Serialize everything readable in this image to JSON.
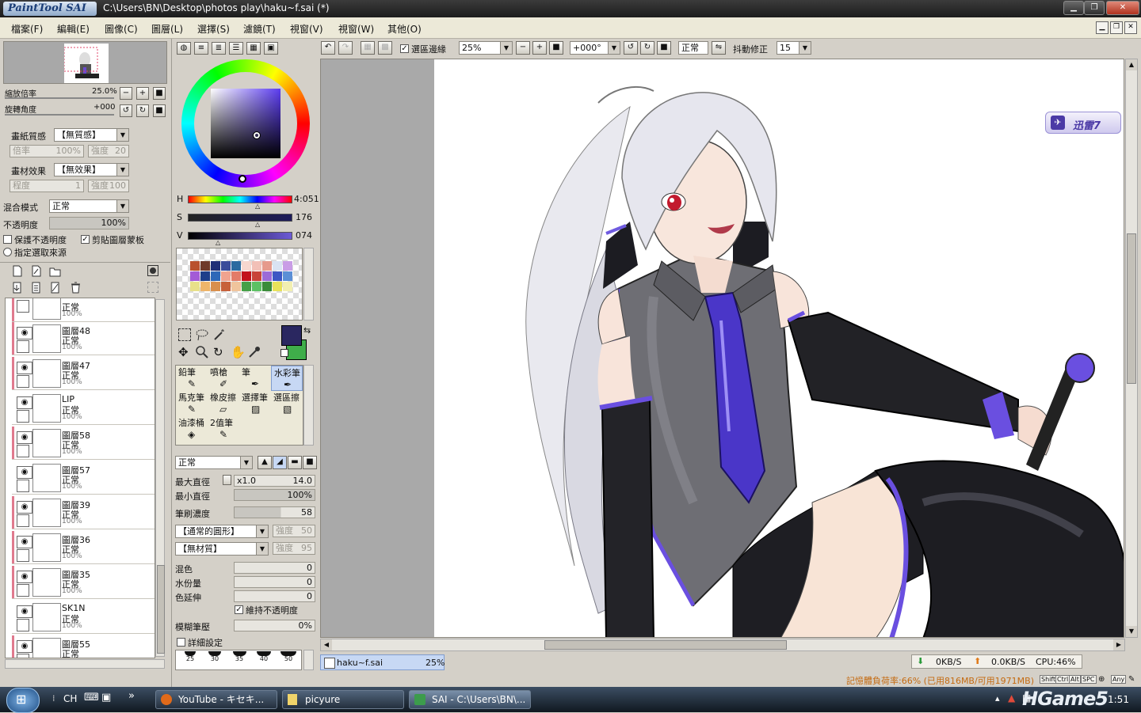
{
  "window": {
    "logo": "PaintTool SAI",
    "title": "C:\\Users\\BN\\Desktop\\photos play\\haku~f.sai (*)"
  },
  "menu": [
    "檔案(F)",
    "編輯(E)",
    "圖像(C)",
    "圖層(L)",
    "選擇(S)",
    "濾鏡(T)",
    "視窗(V)",
    "視窗(W)",
    "其他(O)"
  ],
  "navigator": {
    "zoom_label": "縮放倍率",
    "zoom_value": "25.0%",
    "rotate_label": "旋轉角度",
    "rotate_value": "+000"
  },
  "layer_props": {
    "paper_label": "畫紙質感",
    "paper_value": "【無質感】",
    "paper_scale_label": "倍率",
    "paper_scale_value": "100%",
    "paper_strength_label": "強度",
    "paper_strength_value": "20",
    "effect_label": "畫材效果",
    "effect_value": "【無效果】",
    "effect_degree_label": "程度",
    "effect_degree_value": "1",
    "effect_strength_label": "強度",
    "effect_strength_value": "100",
    "blend_label": "混合模式",
    "blend_value": "正常",
    "opacity_label": "不透明度",
    "opacity_value": "100%",
    "protect_label": "保護不透明度",
    "clip_label": "剪貼圖層蒙板",
    "source_label": "指定選取來源"
  },
  "layers": [
    {
      "name": "",
      "mode": "正常",
      "opacity": "100%"
    },
    {
      "name": "圖層48",
      "mode": "正常",
      "opacity": "100%"
    },
    {
      "name": "圖層47",
      "mode": "正常",
      "opacity": "100%"
    },
    {
      "name": "LIP",
      "mode": "正常",
      "opacity": "100%"
    },
    {
      "name": "圖層58",
      "mode": "正常",
      "opacity": "100%"
    },
    {
      "name": "圖層57",
      "mode": "正常",
      "opacity": "100%"
    },
    {
      "name": "圖層39",
      "mode": "正常",
      "opacity": "100%"
    },
    {
      "name": "圖層36",
      "mode": "正常",
      "opacity": "100%"
    },
    {
      "name": "圖層35",
      "mode": "正常",
      "opacity": "100%"
    },
    {
      "name": "SK1N",
      "mode": "正常",
      "opacity": "100%"
    },
    {
      "name": "圖層55",
      "mode": "正常",
      "opacity": ""
    }
  ],
  "color": {
    "h_label": "H",
    "h_value": "4:051",
    "s_label": "S",
    "s_value": "176",
    "v_label": "V",
    "v_value": "074",
    "fg": "#2a2760",
    "bg": "#3fae4a"
  },
  "swatches": [
    "#b9512e",
    "#6e3a2a",
    "#1f2f77",
    "#3a4c9a",
    "#2a6aa0",
    "#f6d7cf",
    "#f2c0b7",
    "#e69a8c",
    "#d9e3f3",
    "#c99de6",
    "#a35bd6",
    "#1d3f8a",
    "#2e68b8",
    "#f0a38f",
    "#e37b68",
    "#c3131c",
    "#c8443a",
    "#9c6bd8",
    "#3d57c4",
    "#5b8fd6",
    "#e8e08a",
    "#eeb56a",
    "#d98f4d",
    "#c7613a",
    "#f0c49c",
    "#45a047",
    "#5cc163",
    "#3a8c39",
    "#e9e25a",
    "#f2efb0"
  ],
  "tools": [
    {
      "name": "鉛筆"
    },
    {
      "name": "噴槍"
    },
    {
      "name": "筆"
    },
    {
      "name": "水彩筆"
    },
    {
      "name": "馬克筆"
    },
    {
      "name": "橡皮擦"
    },
    {
      "name": "選擇筆"
    },
    {
      "name": "選區擦"
    },
    {
      "name": "油漆桶"
    },
    {
      "name": "2值筆"
    },
    {
      "name": ""
    },
    {
      "name": ""
    }
  ],
  "brush": {
    "mode": "正常",
    "max_size_label": "最大直徑",
    "max_size_mult": "x1.0",
    "max_size_value": "14.0",
    "min_size_label": "最小直徑",
    "min_size_value": "100%",
    "density_label": "筆刷濃度",
    "density_value": "58",
    "shape_value": "【通常的圓形】",
    "shape_strength_label": "強度",
    "shape_strength_value": "50",
    "texture_value": "【無材質】",
    "texture_strength_label": "強度",
    "texture_strength_value": "95",
    "blend_label": "混色",
    "blend_value": "0",
    "water_label": "水份量",
    "water_value": "0",
    "color_ext_label": "色延伸",
    "color_ext_value": "0",
    "keep_opacity_label": "維持不透明度",
    "blur_label": "模糊筆壓",
    "blur_value": "0%",
    "detail_label": "詳細設定",
    "presets": [
      "25",
      "30",
      "35",
      "40",
      "50"
    ]
  },
  "canvas_toolbar": {
    "selection_edge_label": "選區邊緣",
    "zoom": "25%",
    "rotation": "+000°",
    "mode": "正常",
    "stabilizer_label": "抖動修正",
    "stabilizer_value": "15"
  },
  "badge": {
    "text": "迅雷7"
  },
  "doc_tab": {
    "name": "haku~f.sai",
    "zoom": "25%"
  },
  "status": {
    "down": "0KB/S",
    "up": "0.0KB/S",
    "cpu": "CPU:46%",
    "memory": "記憶體負荷率:66% (已用816MB/可用1971MB)",
    "keys": [
      "Shift",
      "Ctrl",
      "Alt",
      "SPC",
      "Any"
    ]
  },
  "taskbar": {
    "lang": "CH",
    "tasks": [
      "YouTube - キセキ...",
      "picyure",
      "SAI - C:\\Users\\BN\\..."
    ],
    "clock": "1:51",
    "watermark": "HGame5"
  }
}
